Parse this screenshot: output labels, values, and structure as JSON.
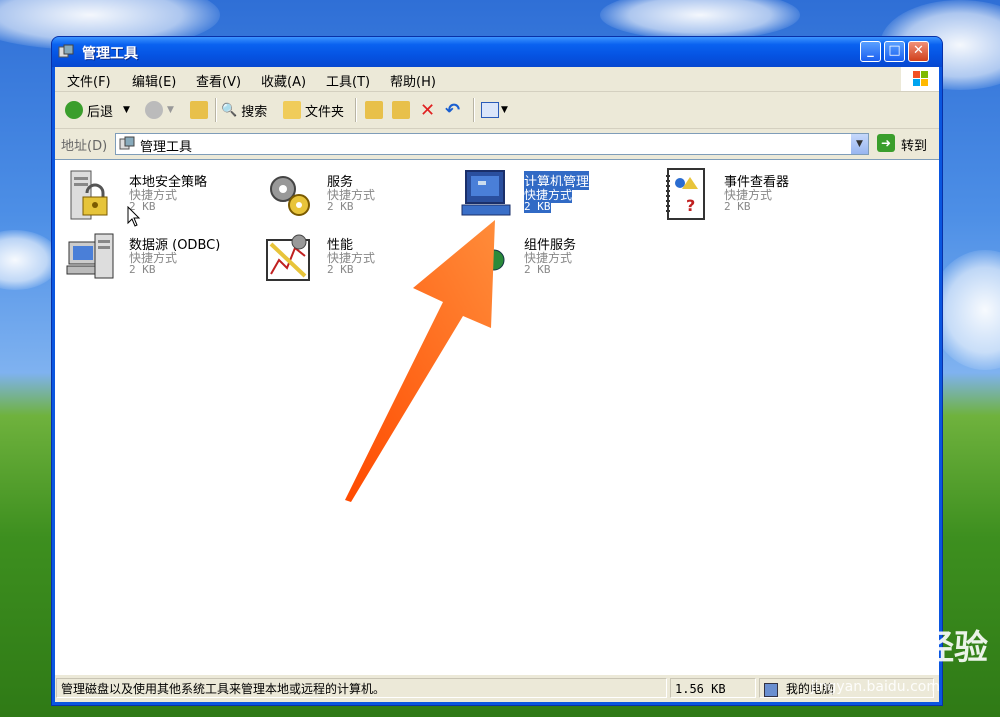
{
  "window": {
    "title": "管理工具"
  },
  "menu": [
    "文件(F)",
    "编辑(E)",
    "查看(V)",
    "收藏(A)",
    "工具(T)",
    "帮助(H)"
  ],
  "toolbar": {
    "back": "后退",
    "search": "搜索",
    "folders": "文件夹"
  },
  "address": {
    "label": "地址(D)",
    "value": "管理工具",
    "go": "转到"
  },
  "items": [
    {
      "name": "本地安全策略",
      "type": "快捷方式",
      "size": "2 KB"
    },
    {
      "name": "服务",
      "type": "快捷方式",
      "size": "2 KB"
    },
    {
      "name": "计算机管理",
      "type": "快捷方式",
      "size": "2 KB"
    },
    {
      "name": "事件查看器",
      "type": "快捷方式",
      "size": "2 KB"
    },
    {
      "name": "数据源 (ODBC)",
      "type": "快捷方式",
      "size": "2 KB"
    },
    {
      "name": "性能",
      "type": "快捷方式",
      "size": "2 KB"
    },
    {
      "name": "组件服务",
      "type": "快捷方式",
      "size": "2 KB"
    }
  ],
  "status": {
    "description": "管理磁盘以及使用其他系统工具来管理本地或远程的计算机。",
    "size": "1.56 KB",
    "zone": "我的电脑"
  },
  "watermark": {
    "brand": "Bai du 经验",
    "url": "jingyan.baidu.com"
  },
  "colors": {
    "selection": "#316ac5",
    "titlebar": "#0a56e0",
    "arrow": "#ff6a1a"
  }
}
